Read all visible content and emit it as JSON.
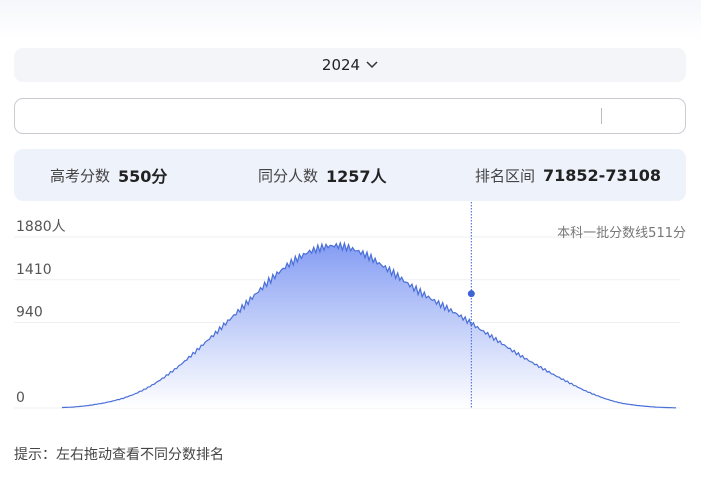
{
  "year_selector": {
    "value": "2024",
    "icon": "chevron-down-icon"
  },
  "slider": {
    "value": 550
  },
  "stats": {
    "score_label": "高考分数",
    "score_value": "550分",
    "count_label": "同分人数",
    "count_value": "1257人",
    "rank_label": "排名区间",
    "rank_value": "71852-73108"
  },
  "chart_data": {
    "type": "area",
    "x_range": [
      150,
      750
    ],
    "ylim": [
      0,
      1880
    ],
    "y_tick_labels": [
      "1880人",
      "1410",
      "940",
      "0"
    ],
    "y_ticks": [
      1880,
      1410,
      940,
      0
    ],
    "annotation": "本科一批分数线511分",
    "marker": {
      "x": 550,
      "y": 1257
    },
    "color": "#4a6fd8",
    "fill_top": "#7d97f2",
    "fill_bottom": "#ffffff",
    "x": [
      150,
      160,
      170,
      180,
      190,
      200,
      210,
      220,
      230,
      240,
      250,
      260,
      270,
      280,
      290,
      300,
      310,
      320,
      330,
      340,
      350,
      360,
      370,
      380,
      390,
      400,
      410,
      420,
      430,
      440,
      450,
      460,
      470,
      480,
      490,
      500,
      510,
      520,
      530,
      540,
      550,
      560,
      570,
      580,
      590,
      600,
      610,
      620,
      630,
      640,
      650,
      660,
      670,
      680,
      690,
      700,
      710,
      720,
      730,
      740,
      750
    ],
    "y": [
      5,
      10,
      20,
      35,
      55,
      80,
      110,
      150,
      200,
      260,
      330,
      410,
      500,
      600,
      710,
      820,
      940,
      1060,
      1180,
      1300,
      1410,
      1500,
      1580,
      1640,
      1690,
      1720,
      1740,
      1745,
      1730,
      1700,
      1660,
      1600,
      1540,
      1470,
      1390,
      1310,
      1230,
      1150,
      1070,
      990,
      910,
      830,
      760,
      690,
      620,
      560,
      500,
      440,
      380,
      320,
      260,
      200,
      150,
      105,
      70,
      45,
      30,
      18,
      10,
      5,
      2
    ]
  },
  "hint": "提示：左右拖动查看不同分数排名"
}
